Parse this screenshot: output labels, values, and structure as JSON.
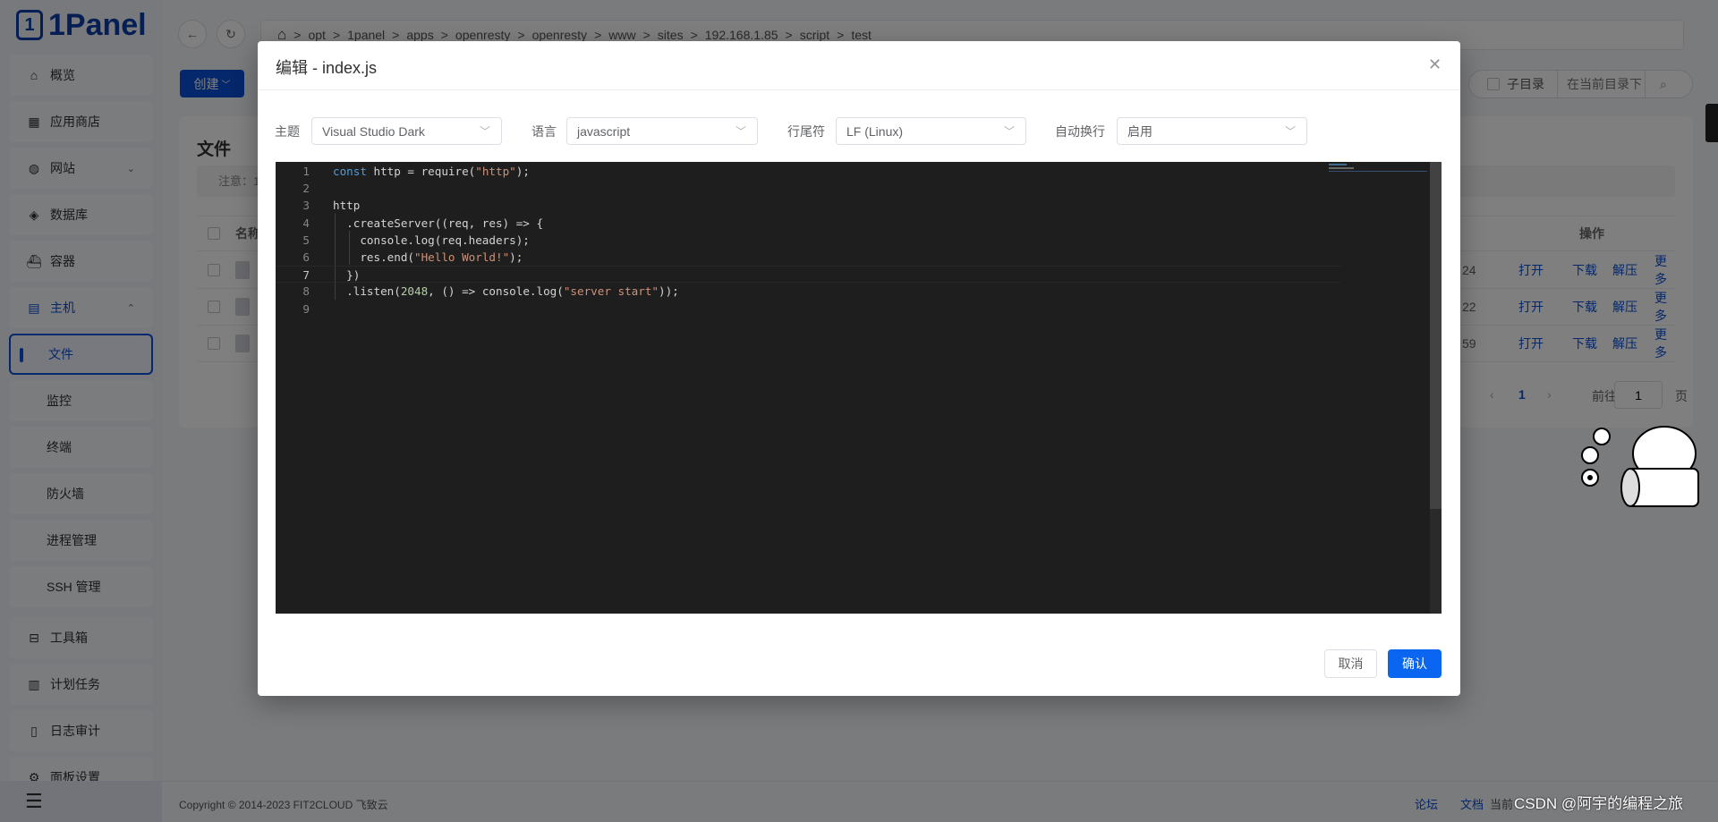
{
  "app": {
    "logo_text": "1Panel"
  },
  "sidebar": {
    "items": [
      {
        "label": "概览",
        "icon": "home-icon",
        "glyph": "⌂"
      },
      {
        "label": "应用商店",
        "icon": "grid-icon",
        "glyph": "▦"
      },
      {
        "label": "网站",
        "icon": "globe-icon",
        "glyph": "◍",
        "chev": "⌄"
      },
      {
        "label": "数据库",
        "icon": "layers-icon",
        "glyph": "◈"
      },
      {
        "label": "容器",
        "icon": "docker-icon",
        "glyph": "⛴"
      },
      {
        "label": "主机",
        "icon": "server-icon",
        "glyph": "▤",
        "chev": "⌃",
        "blue": true
      },
      {
        "label": "文件",
        "sub": true,
        "active": true
      },
      {
        "label": "监控",
        "sub": true
      },
      {
        "label": "终端",
        "sub": true
      },
      {
        "label": "防火墙",
        "sub": true
      },
      {
        "label": "进程管理",
        "sub": true
      },
      {
        "label": "SSH 管理",
        "sub": true
      },
      {
        "label": "工具箱",
        "icon": "toolbox-icon",
        "glyph": "⊟"
      },
      {
        "label": "计划任务",
        "icon": "calendar-icon",
        "glyph": "▥"
      },
      {
        "label": "日志审计",
        "icon": "log-icon",
        "glyph": "▯"
      },
      {
        "label": "面板设置",
        "icon": "settings-icon",
        "glyph": "⚙"
      }
    ]
  },
  "breadcrumb": [
    "opt",
    "1panel",
    "apps",
    "openresty",
    "openresty",
    "www",
    "sites",
    "192.168.1.85",
    "script",
    "test"
  ],
  "toolbar": {
    "create_label": "创建",
    "subdir_label": "子目录",
    "search_placeholder": "在当前目录下"
  },
  "files": {
    "title": "文件",
    "notice": "注意：1",
    "col_name": "名称",
    "col_actions": "操作",
    "rows": [
      {
        "time": "24"
      },
      {
        "time": "22"
      },
      {
        "time": "59"
      }
    ],
    "actions": [
      "打开",
      "下载",
      "解压",
      "更多"
    ],
    "pagination": {
      "current": "1",
      "goto_label": "前往",
      "goto_value": "1",
      "page_suffix": "页"
    }
  },
  "footer": {
    "copyright": "Copyright © 2014-2023 FIT2CLOUD 飞致云",
    "forum": "论坛",
    "docs": "文档",
    "current": "当前",
    "watermark": "CSDN @阿宇的编程之旅"
  },
  "modal": {
    "title": "编辑 - index.js",
    "theme_label": "主题",
    "theme_value": "Visual Studio Dark",
    "lang_label": "语言",
    "lang_value": "javascript",
    "eol_label": "行尾符",
    "eol_value": "LF (Linux)",
    "wrap_label": "自动换行",
    "wrap_value": "启用",
    "cancel": "取消",
    "confirm": "确认",
    "current_line": 7,
    "code": [
      [
        [
          "const",
          "kw"
        ],
        [
          " http = require(",
          ""
        ],
        [
          "\"http\"",
          "str"
        ],
        [
          ");",
          ""
        ]
      ],
      [],
      [
        [
          "http",
          ""
        ]
      ],
      [
        [
          "  .createServer((req, res) => {",
          ""
        ]
      ],
      [
        [
          "    console.log(req.headers);",
          ""
        ]
      ],
      [
        [
          "    res.end(",
          ""
        ],
        [
          "\"Hello World!\"",
          "str"
        ],
        [
          ");",
          ""
        ]
      ],
      [
        [
          "  })",
          ""
        ]
      ],
      [
        [
          "  .listen(",
          ""
        ],
        [
          "2048",
          "numl"
        ],
        [
          ", () => console.log(",
          ""
        ],
        [
          "\"server start\"",
          "str"
        ],
        [
          "));",
          ""
        ]
      ],
      []
    ]
  },
  "colors": {
    "accent": "#0b4fd6",
    "confirm": "#0a66f0",
    "editor_bg": "#1e1e1e"
  }
}
